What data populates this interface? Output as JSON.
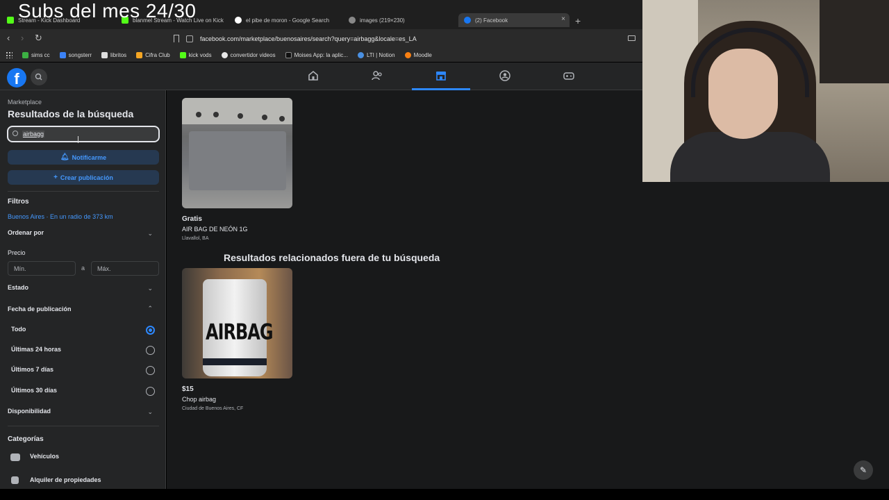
{
  "overlay": {
    "title": "Subs del mes 24/30"
  },
  "browser": {
    "tabs": [
      {
        "label": "Stream - Kick Dashboard",
        "fav_color": "#53fc18"
      },
      {
        "label": "blanmel Stream - Watch Live on Kick",
        "fav_color": "#53fc18"
      },
      {
        "label": "el pibe de moron - Google Search",
        "fav_color": "#ffffff"
      },
      {
        "label": "images (219×230)",
        "fav_color": "#888888"
      },
      {
        "label": "(2) Facebook",
        "fav_color": "#1877f2"
      }
    ],
    "new_tab_label": "+",
    "close_tab_label": "×",
    "url": "facebook.com/marketplace/buenosaires/search?query=airbagg&locale=es_LA",
    "bookmarks": [
      {
        "label": "sims cc",
        "color": "#3cb043"
      },
      {
        "label": "songsterr",
        "color": "#3b82f6"
      },
      {
        "label": "libritos",
        "color": "#dddddd"
      },
      {
        "label": "Cifra Club",
        "color": "#f5a623"
      },
      {
        "label": "kick vods",
        "color": "#53fc18"
      },
      {
        "label": "convertidor videos",
        "color": "#e8e8e8"
      },
      {
        "label": "Moises App: la aplic...",
        "color": "#111111"
      },
      {
        "label": "LTI | Notion",
        "color": "#4a90e2"
      },
      {
        "label": "Moodle",
        "color": "#f98012"
      }
    ]
  },
  "facebook": {
    "logo_letter": "f",
    "sidebar": {
      "breadcrumb": "Marketplace",
      "title": "Resultados de la búsqueda",
      "search_value": "airbagg",
      "notify_button": "Notificarme",
      "create_button": "Crear publicación",
      "filters_heading": "Filtros",
      "location_link": "Buenos Aires · En un radio de 373 km",
      "sort_label": "Ordenar por",
      "price_label": "Precio",
      "price_min_placeholder": "Mín.",
      "price_sep": "a",
      "price_max_placeholder": "Máx.",
      "state_label": "Estado",
      "date_label": "Fecha de publicación",
      "date_options": [
        "Todo",
        "Últimas 24 horas",
        "Últimos 7 días",
        "Últimos 30 días"
      ],
      "availability_label": "Disponibilidad",
      "categories_heading": "Categorías",
      "categories": [
        "Vehículos",
        "Alquiler de propiedades"
      ]
    },
    "results": [
      {
        "price": "Gratis",
        "title": "AIR BAG DE NEÓN 1G",
        "location": "Llavallol, BA"
      }
    ],
    "related_heading": "Resultados relacionados fuera de tu búsqueda",
    "related_results": [
      {
        "price": "$15",
        "title": "Chop airbag",
        "location": "Ciudad de Buenos Aires, CF",
        "image_text": "AIRBAG"
      }
    ],
    "accent_color": "#2d88ff"
  }
}
